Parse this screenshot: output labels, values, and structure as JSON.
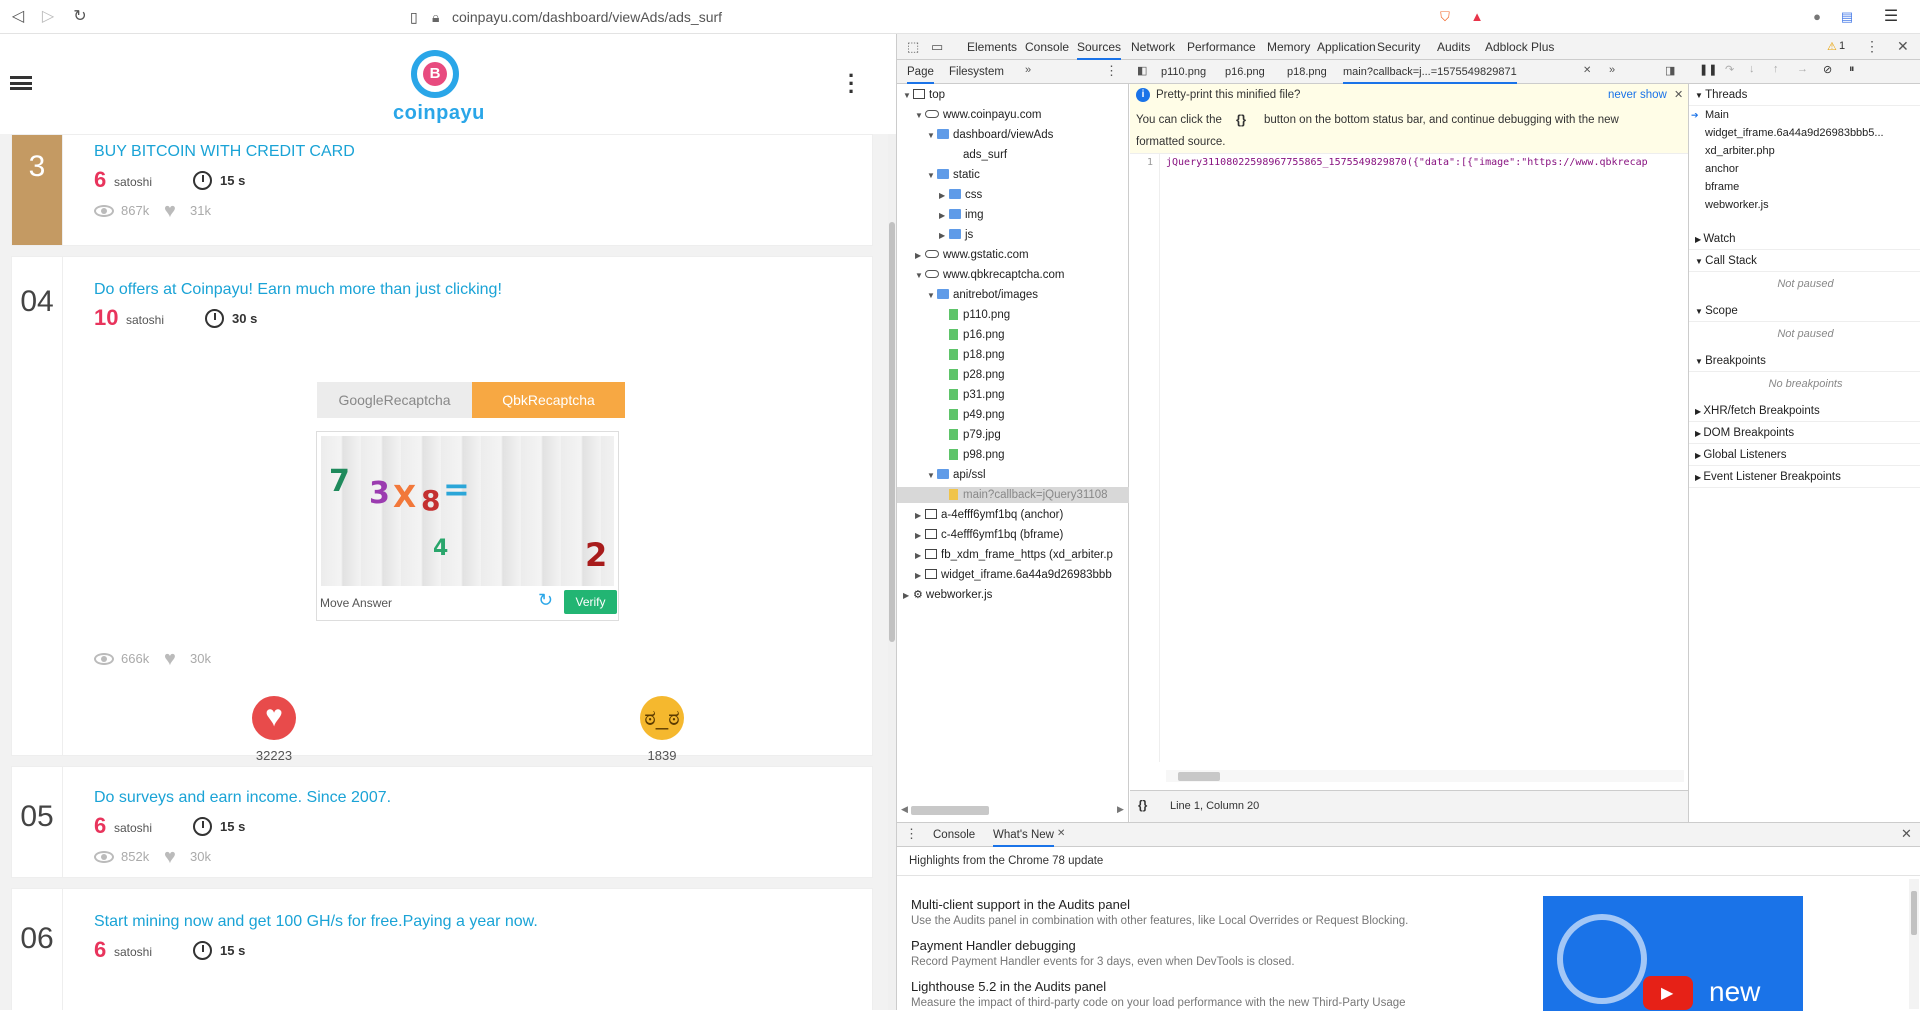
{
  "browser": {
    "url": "coinpayu.com/dashboard/viewAds/ads_surf"
  },
  "site": {
    "logo_text": "coinpayu",
    "cards": [
      {
        "number": "3",
        "title": "BUY BITCOIN WITH CREDIT CARD",
        "satoshi": "6",
        "satoshi_label": "satoshi",
        "time": "15 s",
        "views": "867k",
        "likes": "31k"
      },
      {
        "number": "04",
        "title": "Do offers at Coinpayu! Earn much more than just clicking!",
        "satoshi": "10",
        "satoshi_label": "satoshi",
        "time": "30 s",
        "views": "666k",
        "likes": "30k"
      },
      {
        "number": "05",
        "title": "Do surveys and earn income. Since 2007.",
        "satoshi": "6",
        "satoshi_label": "satoshi",
        "time": "15 s",
        "views": "852k",
        "likes": "30k"
      },
      {
        "number": "06",
        "title": "Start mining now and get 100 GH/s for free.Paying a year now.",
        "satoshi": "6",
        "satoshi_label": "satoshi",
        "time": "15 s"
      }
    ],
    "captcha": {
      "tab_google": "GoogleRecaptcha",
      "tab_qbk": "QbkRecaptcha",
      "glyphs": [
        "7",
        "3",
        "X",
        "8",
        "=",
        "4",
        "2"
      ],
      "move_answer": "Move Answer",
      "verify": "Verify"
    },
    "reactions": {
      "like_count": "32223",
      "angry_count": "1839"
    }
  },
  "devtools": {
    "tabs": [
      "Elements",
      "Console",
      "Sources",
      "Network",
      "Performance",
      "Memory",
      "Application",
      "Security",
      "Audits",
      "Adblock Plus"
    ],
    "active_tab": "Sources",
    "warning_count": "1",
    "nav_tabs": [
      "Page",
      "Filesystem"
    ],
    "editor_tabs": [
      "p110.png",
      "p16.png",
      "p18.png",
      "main?callback=j...=1575549829871"
    ],
    "tree": [
      {
        "depth": 0,
        "kind": "frame",
        "label": "top",
        "open": true
      },
      {
        "depth": 1,
        "kind": "cloud",
        "label": "www.coinpayu.com",
        "open": true
      },
      {
        "depth": 2,
        "kind": "folder",
        "label": "dashboard/viewAds",
        "open": true
      },
      {
        "depth": 3,
        "kind": "none",
        "label": "ads_surf"
      },
      {
        "depth": 2,
        "kind": "folder",
        "label": "static",
        "open": true
      },
      {
        "depth": 3,
        "kind": "folder",
        "label": "css",
        "closed": true
      },
      {
        "depth": 3,
        "kind": "folder",
        "label": "img",
        "closed": true
      },
      {
        "depth": 3,
        "kind": "folder",
        "label": "js",
        "closed": true
      },
      {
        "depth": 1,
        "kind": "cloud",
        "label": "www.gstatic.com",
        "closed": true
      },
      {
        "depth": 1,
        "kind": "cloud",
        "label": "www.qbkrecaptcha.com",
        "open": true
      },
      {
        "depth": 2,
        "kind": "folder",
        "label": "anitrebot/images",
        "open": true
      },
      {
        "depth": 3,
        "kind": "file",
        "label": "p110.png"
      },
      {
        "depth": 3,
        "kind": "file",
        "label": "p16.png"
      },
      {
        "depth": 3,
        "kind": "file",
        "label": "p18.png"
      },
      {
        "depth": 3,
        "kind": "file",
        "label": "p28.png"
      },
      {
        "depth": 3,
        "kind": "file",
        "label": "p31.png"
      },
      {
        "depth": 3,
        "kind": "file",
        "label": "p49.png"
      },
      {
        "depth": 3,
        "kind": "file",
        "label": "p79.jpg"
      },
      {
        "depth": 3,
        "kind": "file",
        "label": "p98.png"
      },
      {
        "depth": 2,
        "kind": "folder",
        "label": "api/ssl",
        "open": true
      },
      {
        "depth": 3,
        "kind": "filey",
        "label": "main?callback=jQuery31108",
        "selected": true
      },
      {
        "depth": 1,
        "kind": "frame",
        "label": "a-4efff6ymf1bq (anchor)",
        "closed": true
      },
      {
        "depth": 1,
        "kind": "frame",
        "label": "c-4efff6ymf1bq (bframe)",
        "closed": true
      },
      {
        "depth": 1,
        "kind": "frame",
        "label": "fb_xdm_frame_https (xd_arbiter.p",
        "closed": true
      },
      {
        "depth": 1,
        "kind": "frame",
        "label": "widget_iframe.6a44a9d26983bbb",
        "closed": true
      },
      {
        "depth": 0,
        "kind": "gear",
        "label": "webworker.js",
        "closed": true
      }
    ],
    "infobar": {
      "question": "Pretty-print this minified file?",
      "never_show": "never show",
      "hint_before": "You can click the",
      "hint_braces": "{}",
      "hint_after": "button on the bottom status bar, and continue debugging with the new",
      "hint_line2": "formatted source."
    },
    "code": {
      "line_number": "1",
      "text": "jQuery31108022598967755865_1575549829870({\"data\":[{\"image\":\"https://www.qbkrecap"
    },
    "status": {
      "braces": "{}",
      "position": "Line 1, Column 20"
    },
    "threads": {
      "label": "Threads",
      "items": [
        "Main",
        "widget_iframe.6a44a9d26983bbb5...",
        "xd_arbiter.php",
        "anchor",
        "bframe",
        "webworker.js"
      ]
    },
    "sections": {
      "watch": "Watch",
      "call_stack": "Call Stack",
      "call_stack_empty": "Not paused",
      "scope": "Scope",
      "scope_empty": "Not paused",
      "breakpoints": "Breakpoints",
      "breakpoints_empty": "No breakpoints",
      "xhr": "XHR/fetch Breakpoints",
      "dom": "DOM Breakpoints",
      "global": "Global Listeners",
      "event": "Event Listener Breakpoints"
    },
    "drawer": {
      "tabs": [
        "Console",
        "What's New"
      ],
      "highlights": "Highlights from the Chrome 78 update",
      "items": [
        {
          "title": "Multi-client support in the Audits panel",
          "desc": "Use the Audits panel in combination with other features, like Local Overrides or Request Blocking."
        },
        {
          "title": "Payment Handler debugging",
          "desc": "Record Payment Handler events for 3 days, even when DevTools is closed."
        },
        {
          "title": "Lighthouse 5.2 in the Audits panel",
          "desc": "Measure the impact of third-party code on your load performance with the new Third-Party Usage"
        }
      ],
      "video_text": "new"
    }
  }
}
